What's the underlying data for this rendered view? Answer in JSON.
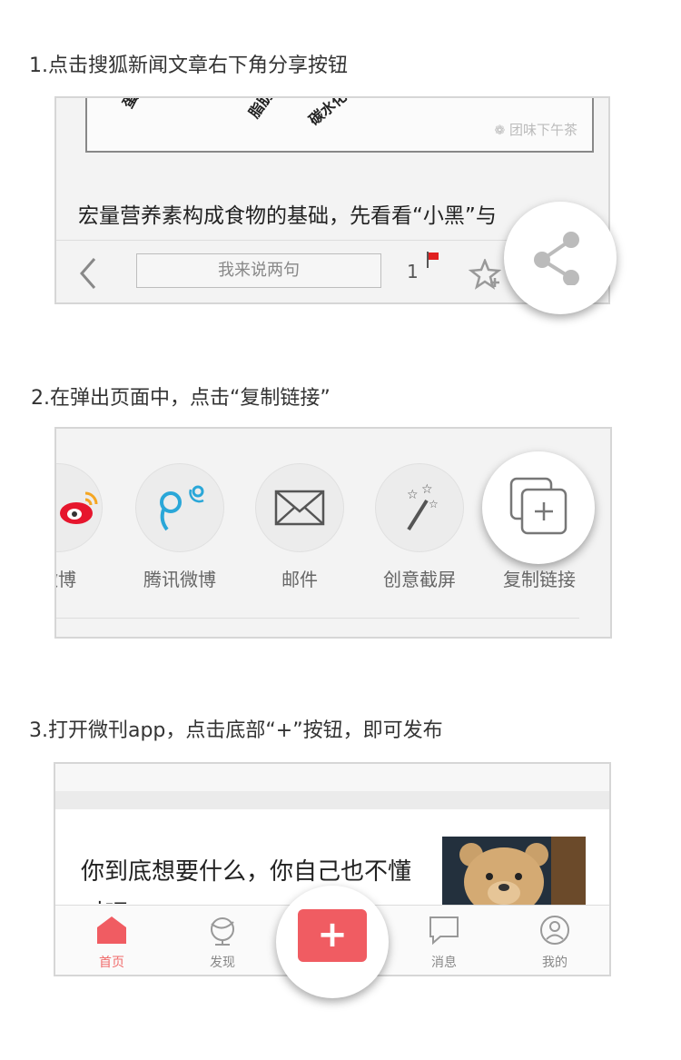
{
  "steps": [
    {
      "title": "1.点击搜狐新闻文章右下角分享按钮"
    },
    {
      "title": "2.在弹出页面中，点击“复制链接”"
    },
    {
      "title": "3.打开微刊app，点击底部“+”按钮，即可发布"
    }
  ],
  "article": {
    "headline": "宏量营养素构成食物的基础，先看看“小黑”与",
    "image_watermark": "团味下午茶",
    "image_handwriting": [
      "蛋",
      "脂肪",
      "碳水化"
    ],
    "comment_placeholder": "我来说两句",
    "comment_count": "1",
    "accent_color": "#e02020"
  },
  "share_sheet": {
    "items": [
      {
        "label": "微博",
        "icon": "weibo-icon"
      },
      {
        "label": "腾讯微博",
        "icon": "tencent-weibo-icon"
      },
      {
        "label": "邮件",
        "icon": "mail-icon"
      },
      {
        "label": "创意截屏",
        "icon": "magic-wand-icon"
      },
      {
        "label": "复制链接",
        "icon": "copy-link-icon"
      }
    ]
  },
  "weikan": {
    "feed_title": "你到底想要什么，你自己也不懂对吧",
    "nav": [
      {
        "label": "首页",
        "icon": "home-icon",
        "active": true
      },
      {
        "label": "发现",
        "icon": "globe-icon",
        "active": false
      },
      {
        "label": "+",
        "icon": "plus-icon",
        "active": false
      },
      {
        "label": "消息",
        "icon": "message-icon",
        "active": false
      },
      {
        "label": "我的",
        "icon": "profile-icon",
        "active": false
      }
    ],
    "accent_color": "#f05c62"
  }
}
